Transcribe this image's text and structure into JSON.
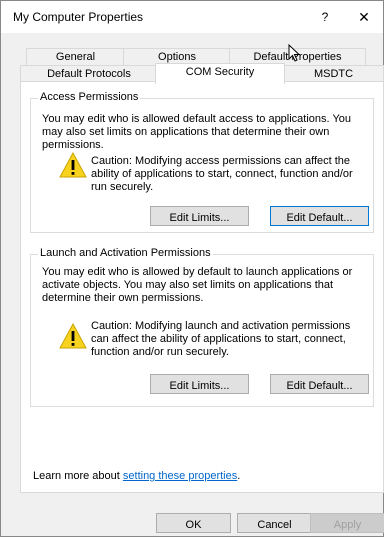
{
  "window": {
    "title": "My Computer Properties",
    "help_glyph": "?",
    "close_glyph": "✕"
  },
  "tabs": {
    "row1": [
      "General",
      "Options",
      "Default Properties"
    ],
    "row2": [
      "Default Protocols",
      "COM Security",
      "MSDTC"
    ],
    "selected": "COM Security"
  },
  "access": {
    "title": "Access Permissions",
    "description": "You may edit who is allowed default access to applications. You may also set limits on applications that determine their own permissions.",
    "caution": "Caution: Modifying access permissions can affect the ability of applications to start, connect, function and/or run securely.",
    "edit_limits": "Edit Limits...",
    "edit_default": "Edit Default..."
  },
  "launch": {
    "title": "Launch and Activation Permissions",
    "description": "You may edit who is allowed by default to launch applications or activate objects. You may also set limits on applications that determine their own permissions.",
    "caution": "Caution: Modifying launch and activation permissions can affect the ability of applications to start, connect, function and/or run securely.",
    "edit_limits": "Edit Limits...",
    "edit_default": "Edit Default..."
  },
  "learn_more": {
    "prefix": "Learn more about ",
    "link": "setting these properties",
    "suffix": "."
  },
  "footer": {
    "ok": "OK",
    "cancel": "Cancel",
    "apply": "Apply"
  },
  "colors": {
    "warning_yellow": "#f7d21f",
    "link_blue": "#0066cc",
    "default_button_border": "#0078d7"
  }
}
